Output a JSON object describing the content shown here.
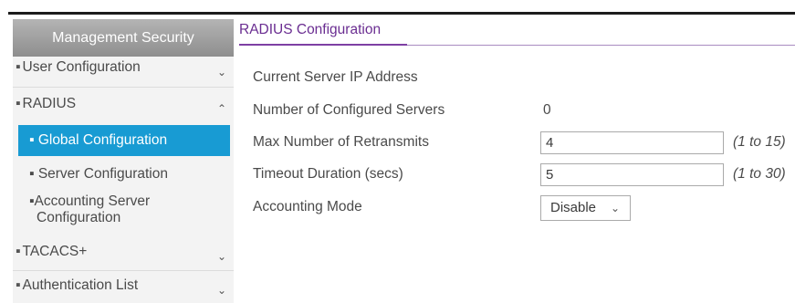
{
  "sidebar": {
    "header": "Management Security",
    "items": [
      {
        "label": "User Configuration",
        "expanded": false
      },
      {
        "label": "RADIUS",
        "expanded": true
      },
      {
        "label": "TACACS+",
        "expanded": false
      },
      {
        "label": "Authentication List",
        "expanded": false
      }
    ],
    "subitems": [
      {
        "label": "Global Configuration",
        "active": true
      },
      {
        "label": "Server Configuration",
        "active": false
      },
      {
        "label_line1": "Accounting Server",
        "label_line2": "Configuration",
        "active": false
      }
    ],
    "bullet": "▪",
    "chevron_down": "⌄",
    "chevron_up": "⌃"
  },
  "main": {
    "title": "RADIUS Configuration",
    "fields": {
      "current_server_ip": {
        "label": "Current Server IP Address",
        "value": ""
      },
      "num_servers": {
        "label": "Number of Configured Servers",
        "value": "0"
      },
      "max_retransmits": {
        "label": "Max Number of Retransmits",
        "value": "4",
        "range": "(1 to 15)"
      },
      "timeout": {
        "label": "Timeout Duration (secs)",
        "value": "5",
        "range": "(1 to 30)"
      },
      "accounting_mode": {
        "label": "Accounting Mode",
        "value": "Disable"
      }
    }
  },
  "colors": {
    "accent": "#189bd3",
    "title": "#6a2d91",
    "header_gray": "#9e9e9e"
  }
}
